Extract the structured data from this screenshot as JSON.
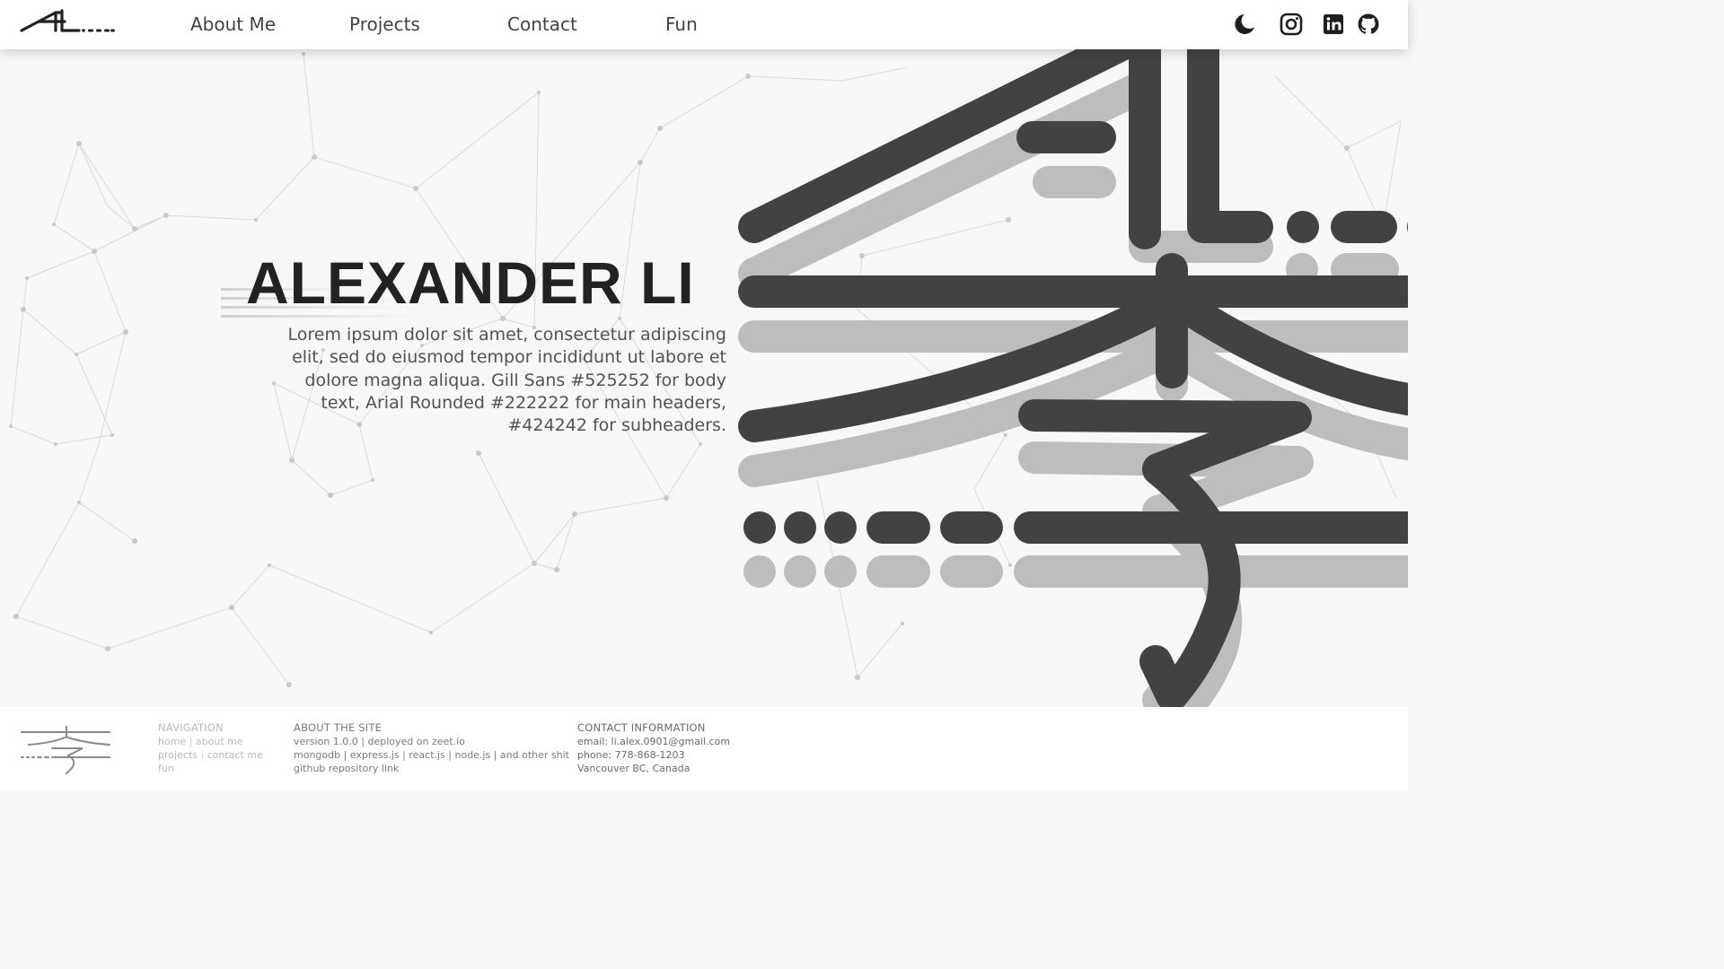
{
  "header": {
    "logo_alt": "AL logo",
    "nav": [
      {
        "label": "About Me"
      },
      {
        "label": "Projects"
      },
      {
        "label": "Contact"
      },
      {
        "label": "Fun"
      }
    ],
    "icons": [
      "moon-icon",
      "instagram-icon",
      "linkedin-icon",
      "github-icon"
    ]
  },
  "hero": {
    "title": "ALEXANDER LI",
    "body": "Lorem ipsum dolor sit amet, consectetur adipiscing elit, sed do eiusmod tempor incididunt ut labore et dolore magna aliqua. Gill Sans #525252 for body text, Arial Rounded #222222 for main headers, #424242 for subheaders."
  },
  "footer": {
    "navigation": {
      "heading": "NAVIGATION",
      "links": [
        "home",
        "about me",
        "projects",
        "contact me",
        "fun"
      ]
    },
    "about": {
      "heading": "ABOUT THE SITE",
      "line1": "version 1.0.0 | deployed on zeet.io",
      "line2": "mongodb | express.js | react.js | node.js | and other shit",
      "line3": "github repository link"
    },
    "contact": {
      "heading": "CONTACT INFORMATION",
      "email": "email: li.alex.0901@gmail.com",
      "phone": "phone: 778-868-1203",
      "location": "Vancouver BC, Canada"
    }
  },
  "colors": {
    "title": "#222222",
    "body": "#525252",
    "subheader": "#424242",
    "glyph_dark": "#424242",
    "glyph_shadow": "#bdbdbd"
  }
}
